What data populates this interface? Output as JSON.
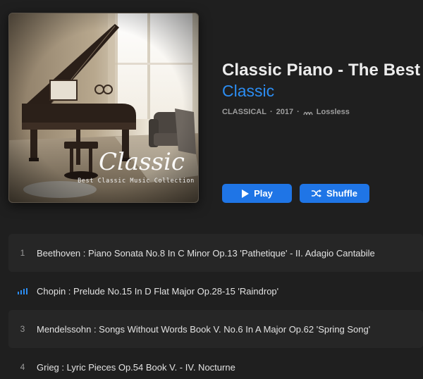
{
  "album": {
    "title": "Classic Piano - The Best",
    "artist": "Classic",
    "genre": "CLASSICAL",
    "separator1": "·",
    "year": "2017",
    "separator2": "·",
    "quality": "Lossless",
    "quality_icon": "lossless-waveform-icon",
    "artwork": {
      "cover_text": "Classic",
      "cover_subtitle": "Best Classic Music Collection"
    }
  },
  "buttons": {
    "play_label": "Play",
    "play_icon": "play-icon",
    "shuffle_label": "Shuffle",
    "shuffle_icon": "shuffle-icon"
  },
  "tracks": [
    {
      "number": "1",
      "title": "Beethoven : Piano Sonata No.8 In C Minor Op.13 'Pathetique' - II. Adagio Cantabile",
      "playing": false
    },
    {
      "number": "",
      "title": "Chopin : Prelude No.15 In D Flat Major Op.28-15 'Raindrop'",
      "playing": true,
      "indicator_icon": "now-playing-bars-icon"
    },
    {
      "number": "3",
      "title": "Mendelssohn : Songs Without Words Book V. No.6 In A Major Op.62 'Spring Song'",
      "playing": false
    },
    {
      "number": "4",
      "title": "Grieg : Lyric Pieces Op.54 Book V. - IV. Nocturne",
      "playing": false
    }
  ],
  "colors": {
    "background": "#1f1f1f",
    "accent": "#2c8df2",
    "button": "#1f75e6",
    "row_alt": "#262626"
  }
}
